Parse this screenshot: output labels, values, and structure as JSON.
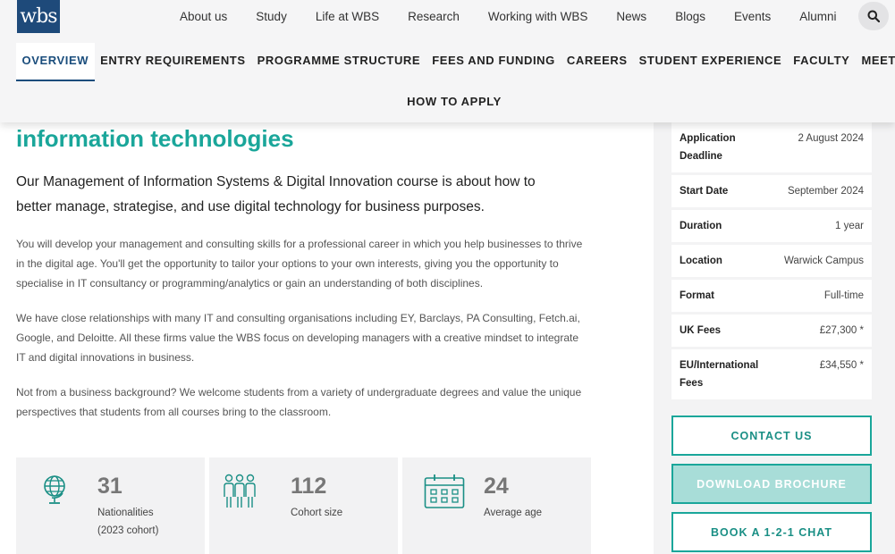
{
  "brand": {
    "logo_text": "wbs"
  },
  "topnav": [
    "About us",
    "Study",
    "Life at WBS",
    "Research",
    "Working with WBS",
    "News",
    "Blogs",
    "Events",
    "Alumni"
  ],
  "subnav": {
    "row1": [
      "OVERVIEW",
      "ENTRY REQUIREMENTS",
      "PROGRAMME STRUCTURE",
      "FEES AND FUNDING",
      "CAREERS",
      "STUDENT EXPERIENCE",
      "FACULTY",
      "MEET US"
    ],
    "row2": "HOW TO APPLY"
  },
  "main": {
    "title": "information technologies",
    "lead": "Our Management of Information Systems & Digital Innovation course is about how to better manage, strategise, and use digital technology for business purposes.",
    "paragraphs": [
      "You will develop your management and consulting skills for a professional career in which you help businesses to thrive in the digital age. You'll get the opportunity to tailor your options to your own interests, giving you the opportunity to specialise in IT consultancy or programming/analytics or gain an understanding of both disciplines.",
      "We have close relationships with many IT and consulting organisations including EY, Barclays, PA Consulting, Fetch.ai, Google, and Deloitte. All these firms value the WBS focus on developing managers with a creative mindset to integrate IT and digital innovations in business.",
      "Not from a business background? We welcome students from a variety of undergraduate degrees and value the unique perspectives that students from all courses bring to the classroom."
    ]
  },
  "stats": [
    {
      "icon": "globe-icon",
      "value": "31",
      "label": "Nationalities",
      "sub": "(2023 cohort)"
    },
    {
      "icon": "people-icon",
      "value": "112",
      "label": "Cohort size",
      "sub": ""
    },
    {
      "icon": "calendar-icon",
      "value": "24",
      "label": "Average age",
      "sub": ""
    }
  ],
  "info": [
    {
      "key": "Application Deadline",
      "value": "2 August 2024"
    },
    {
      "key": "Start Date",
      "value": "September 2024"
    },
    {
      "key": "Duration",
      "value": "1 year"
    },
    {
      "key": "Location",
      "value": "Warwick Campus"
    },
    {
      "key": "Format",
      "value": "Full-time"
    },
    {
      "key": "UK Fees",
      "value": "£27,300 *"
    },
    {
      "key": "EU/International Fees",
      "value": "£34,550 *"
    }
  ],
  "buttons": {
    "contact": "CONTACT US",
    "brochure": "DOWNLOAD BROCHURE",
    "chat": "BOOK A 1-2-1 CHAT"
  },
  "colors": {
    "teal": "#1aa69a",
    "navy": "#1a4d7c",
    "panel_bg": "#f3f3f4"
  }
}
